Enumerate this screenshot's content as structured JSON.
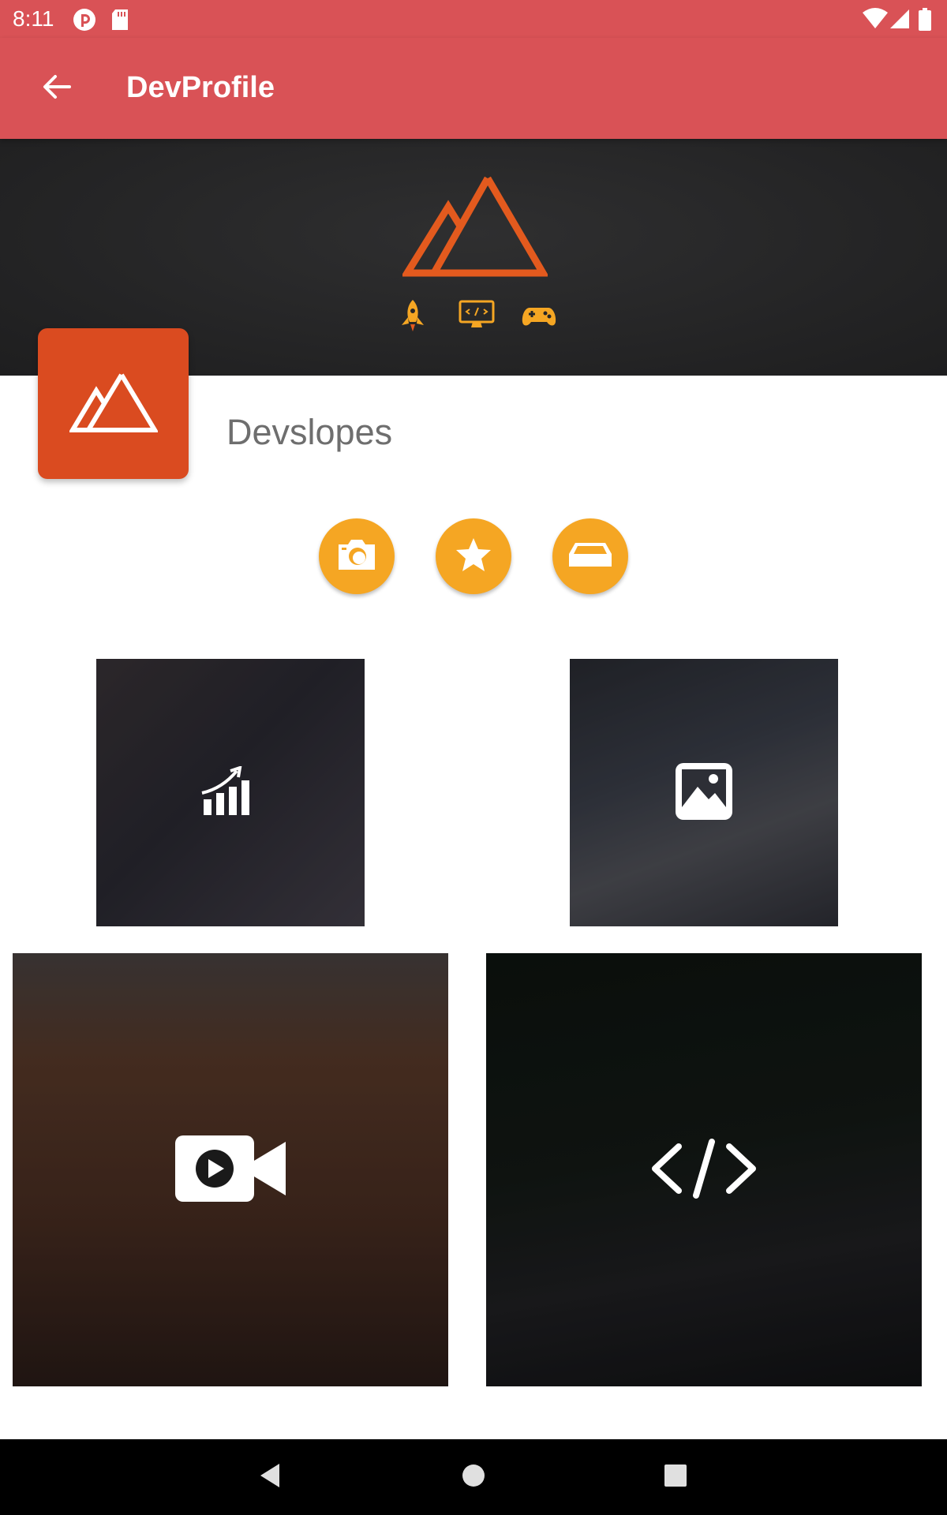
{
  "status_bar": {
    "time": "8:11",
    "icons": [
      "pocket-casts-icon",
      "sd-card-icon",
      "wifi-icon",
      "signal-icon",
      "battery-icon"
    ]
  },
  "app_bar": {
    "title": "DevProfile",
    "back_icon": "arrow-left-icon"
  },
  "banner": {
    "logo": "devslopes-mountain-logo",
    "icons": [
      "rocket-icon",
      "code-monitor-icon",
      "gamepad-icon"
    ],
    "accent_color": "#e35a1e"
  },
  "profile": {
    "name": "Devslopes",
    "logo_color": "#da4b20"
  },
  "actions": [
    {
      "icon": "camera-icon"
    },
    {
      "icon": "star-icon"
    },
    {
      "icon": "inbox-icon"
    }
  ],
  "tiles": [
    {
      "icon": "bar-chart-icon"
    },
    {
      "icon": "image-icon"
    },
    {
      "icon": "video-camera-icon"
    },
    {
      "icon": "code-icon"
    }
  ],
  "colors": {
    "primary": "#d95256",
    "accent": "#f5a623",
    "banner_bg": "#262627"
  },
  "nav_bar": {
    "icons": [
      "back-triangle-icon",
      "home-circle-icon",
      "recents-square-icon"
    ]
  }
}
